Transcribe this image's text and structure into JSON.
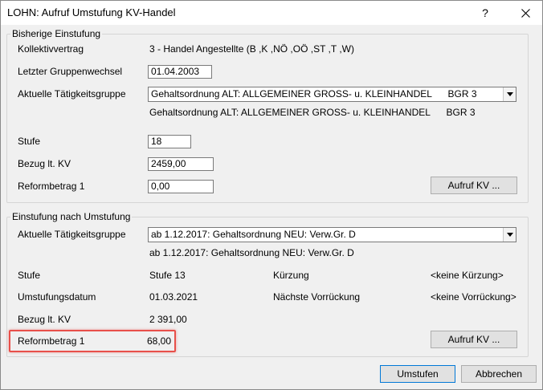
{
  "window": {
    "title": "LOHN: Aufruf Umstufung KV-Handel",
    "help_label": "?",
    "colors": {
      "highlight": "#e8504a",
      "focus_border": "#0078d7"
    }
  },
  "bisherige": {
    "legend": "Bisherige Einstufung",
    "kollektivvertrag_label": "Kollektivvertrag",
    "kollektivvertrag_value": "3 - Handel Angestellte (B ,K ,NÖ ,OÖ ,ST ,T ,W)",
    "gruppenwechsel_label": "Letzter Gruppenwechsel",
    "gruppenwechsel_value": "01.04.2003",
    "taetigkeit_label": "Aktuelle Tätigkeitsgruppe",
    "taetigkeit_selected": "Gehaltsordnung ALT: ALLGEMEINER GROSS- u. KLEINHANDEL      BGR 3",
    "taetigkeit_text": "Gehaltsordnung ALT: ALLGEMEINER GROSS- u. KLEINHANDEL      BGR 3",
    "stufe_label": "Stufe",
    "stufe_value": "18",
    "bezug_label": "Bezug lt. KV",
    "bezug_value": "2459,00",
    "reform_label": "Reformbetrag 1",
    "reform_value": "0,00",
    "aufruf_button": "Aufruf KV ..."
  },
  "nach": {
    "legend": "Einstufung nach Umstufung",
    "taetigkeit_label": "Aktuelle Tätigkeitsgruppe",
    "taetigkeit_selected": "ab 1.12.2017: Gehaltsordnung NEU: Verw.Gr. D",
    "taetigkeit_text": "ab 1.12.2017: Gehaltsordnung NEU: Verw.Gr. D",
    "stufe_label": "Stufe",
    "stufe_value": "Stufe 13",
    "kuerzung_label": "Kürzung",
    "kuerzung_value": "<keine Kürzung>",
    "datum_label": "Umstufungsdatum",
    "datum_value": "01.03.2021",
    "vorrueckung_label": "Nächste Vorrückung",
    "vorrueckung_value": "<keine Vorrückung>",
    "bezug_label": "Bezug lt. KV",
    "bezug_value": "2 391,00",
    "reform_label": "Reformbetrag 1",
    "reform_value": "68,00",
    "aufruf_button": "Aufruf KV ..."
  },
  "footer": {
    "umstufen_button": "Umstufen",
    "abbrechen_button": "Abbrechen"
  }
}
